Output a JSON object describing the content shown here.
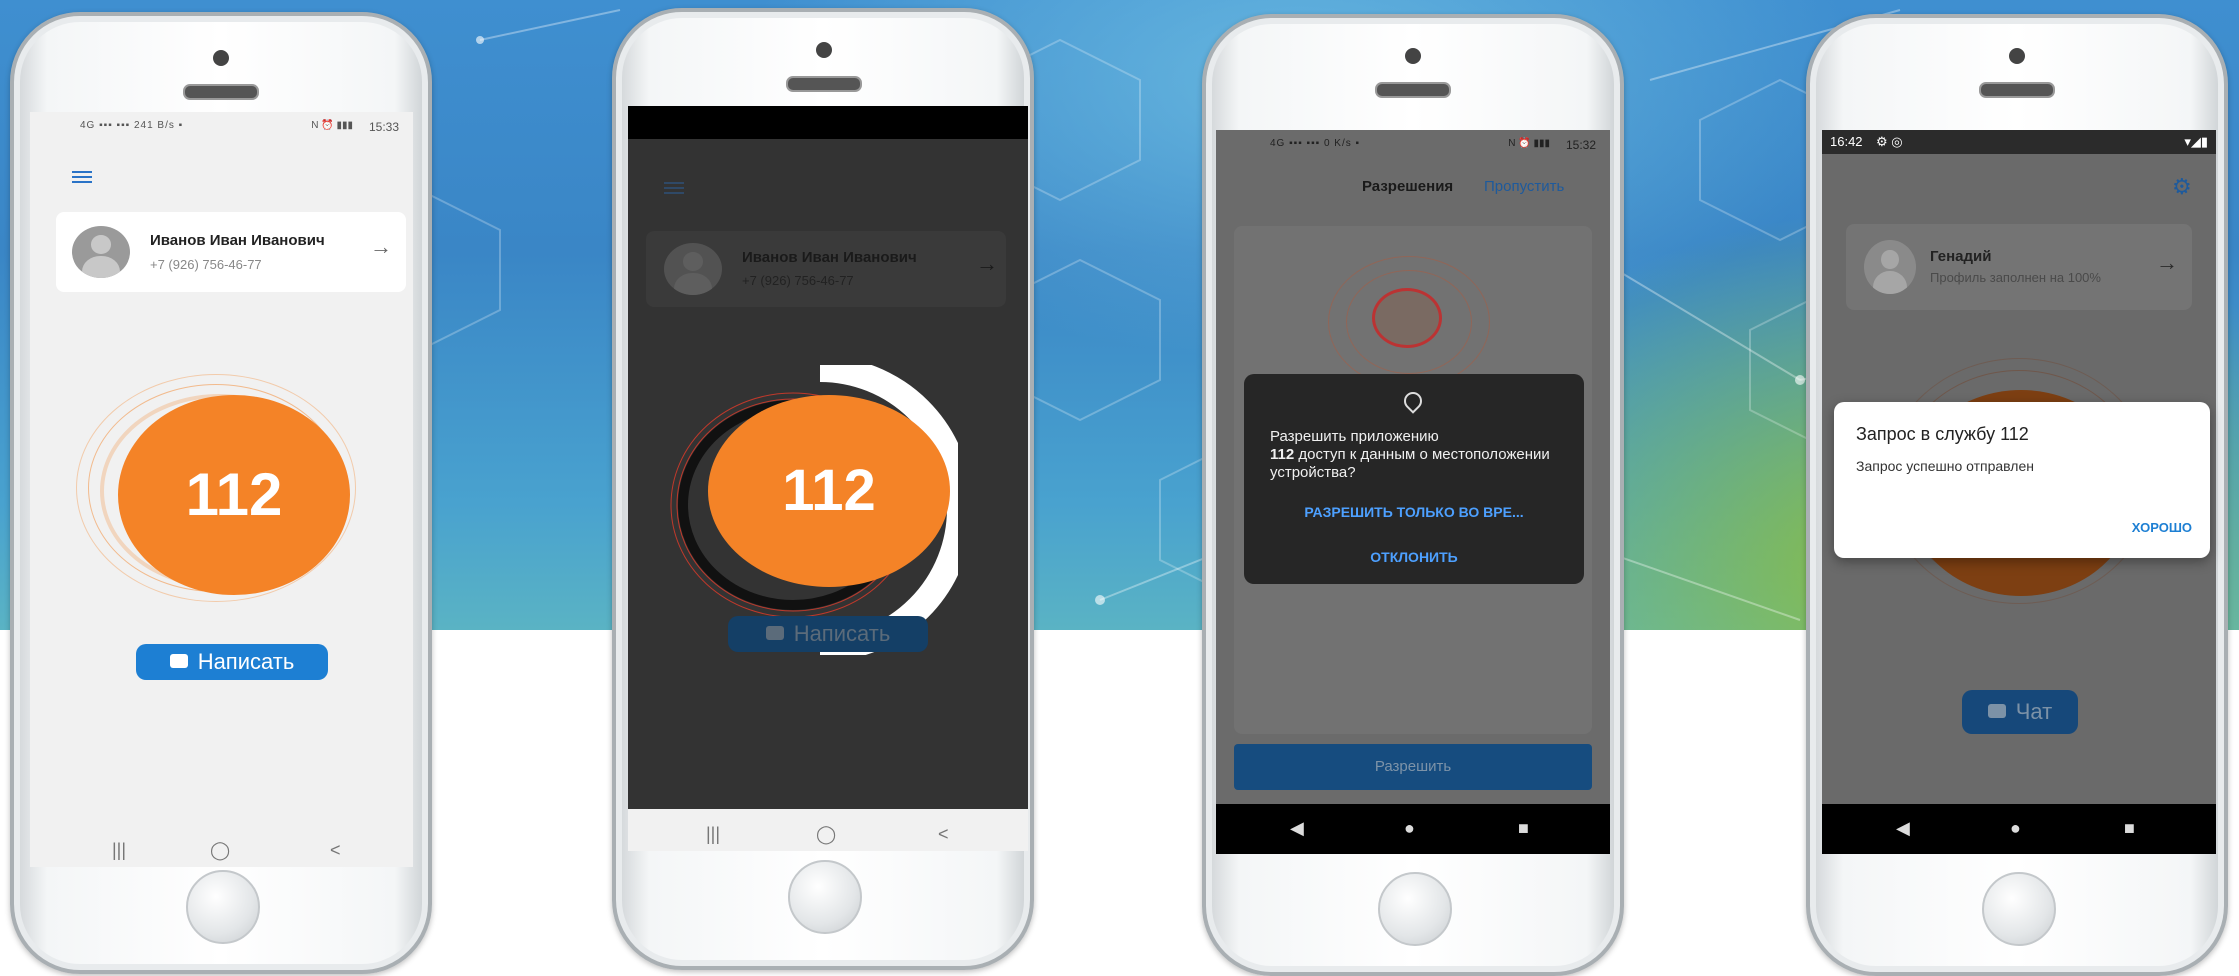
{
  "phone1": {
    "status_time": "15:33",
    "status_icons": "4G ▪▪▪ ▪▪▪ 241 B/s ▪",
    "status_right_icons": "N ⏰ ▮▮▮",
    "profile_name": "Иванов Иван Иванович",
    "profile_phone": "+7 (926) 756-46-77",
    "sos_label": "112",
    "write_button": "Написать",
    "nav_recent": "|||",
    "nav_home": "◯",
    "nav_back": "<"
  },
  "phone2": {
    "profile_name": "Иванов Иван Иванович",
    "profile_phone": "+7 (926) 756-46-77",
    "sos_label": "112",
    "write_button": "Написать",
    "nav_recent": "|||",
    "nav_home": "◯",
    "nav_back": "<"
  },
  "phone3": {
    "status_time": "15:32",
    "status_icons": "4G ▪▪▪ ▪▪▪ 0 K/s ▪",
    "status_right_icons": "N ⏰ ▮▮▮",
    "tab_permissions": "Разрешения",
    "tab_skip": "Пропустить",
    "dialog_text_prefix": "Разрешить приложению",
    "dialog_text_app": "112",
    "dialog_text_suffix": "доступ к данным о местоположении устройства?",
    "allow_while_using": "РАЗРЕШИТЬ ТОЛЬКО ВО ВРЕ...",
    "deny": "ОТКЛОНИТЬ",
    "allow_button": "Разрешить",
    "nav_back": "◀",
    "nav_home": "●",
    "nav_recent": "■"
  },
  "phone4": {
    "status_time": "16:42",
    "profile_name": "Генадий",
    "profile_subtitle": "Профиль заполнен на 100%",
    "dialog_title": "Запрос в службу 112",
    "dialog_message": "Запрос успешно отправлен",
    "dialog_ok": "ХОРОШО",
    "chat_button": "Чат",
    "nav_back": "◀",
    "nav_home": "●",
    "nav_recent": "■"
  },
  "colors": {
    "accent_orange": "#f48327",
    "accent_blue": "#1d7fd3",
    "link_blue": "#2d8cff"
  }
}
